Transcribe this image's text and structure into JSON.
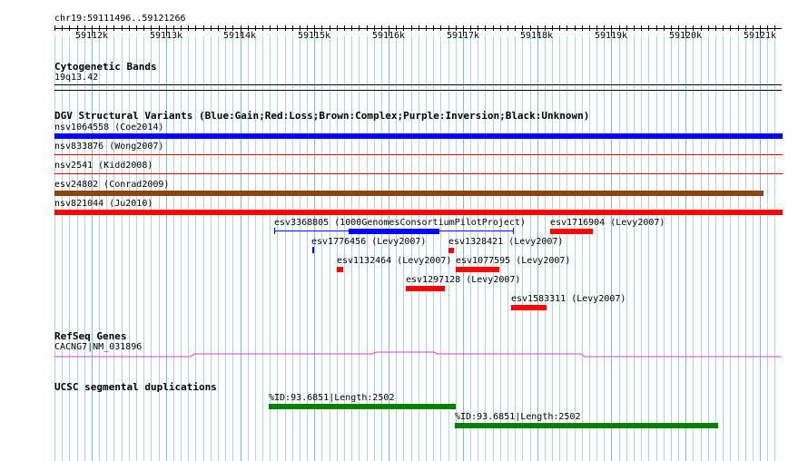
{
  "ruler": {
    "region": "chr19:59111496..59121266",
    "ticks": [
      "59112k",
      "59113k",
      "59114k",
      "59115k",
      "59116k",
      "59117k",
      "59118k",
      "59119k",
      "59120k",
      "59121k"
    ]
  },
  "tracks": {
    "cytobands": {
      "title": "Cytogenetic Bands",
      "band": "19q13.42"
    },
    "dgv": {
      "title": "DGV Structural Variants (Blue:Gain;Red:Loss;Brown:Complex;Purple:Inversion;Black:Unknown)",
      "variants": [
        {
          "label": "nsv1064558 (Coe2014)",
          "color": "#0000ff"
        },
        {
          "label": "nsv833876 (Wong2007)",
          "color": "#cc0000"
        },
        {
          "label": "nsv2541 (Kidd2008)",
          "color": "#cc0000"
        },
        {
          "label": "esv24802 (Conrad2009)",
          "color": "#8b4513"
        },
        {
          "label": "nsv821044 (Ju2010)",
          "color": "#ff0000"
        },
        {
          "label": "esv3368805 (1000GenomesConsortiumPilotProject)",
          "color": "#0000ff"
        },
        {
          "label": "esv1716904 (Levy2007)",
          "color": "#ff0000"
        },
        {
          "label": "esv1776456 (Levy2007)",
          "color": "#0000ff"
        },
        {
          "label": "esv1328421 (Levy2007)",
          "color": "#ff0000"
        },
        {
          "label": "esv1132464 (Levy2007)",
          "color": "#ff0000"
        },
        {
          "label": "esv1077595 (Levy2007)",
          "color": "#ff0000"
        },
        {
          "label": "esv1297128 (Levy2007)",
          "color": "#ff0000"
        },
        {
          "label": "esv1583311 (Levy2007)",
          "color": "#ff0000"
        }
      ]
    },
    "refseq": {
      "title": "RefSeq Genes",
      "gene": "CACNG7|NM_031896",
      "color": "#cc44cc"
    },
    "segdups": {
      "title": "UCSC segmental duplications",
      "items": [
        {
          "label": "%ID:93.6851|Length:2502",
          "color": "#008000"
        },
        {
          "label": "%ID:93.6851|Length:2502",
          "color": "#008000"
        }
      ]
    }
  },
  "colors": {
    "grid": "#a8d8d8",
    "gridMajor": "#7cc4c4"
  }
}
